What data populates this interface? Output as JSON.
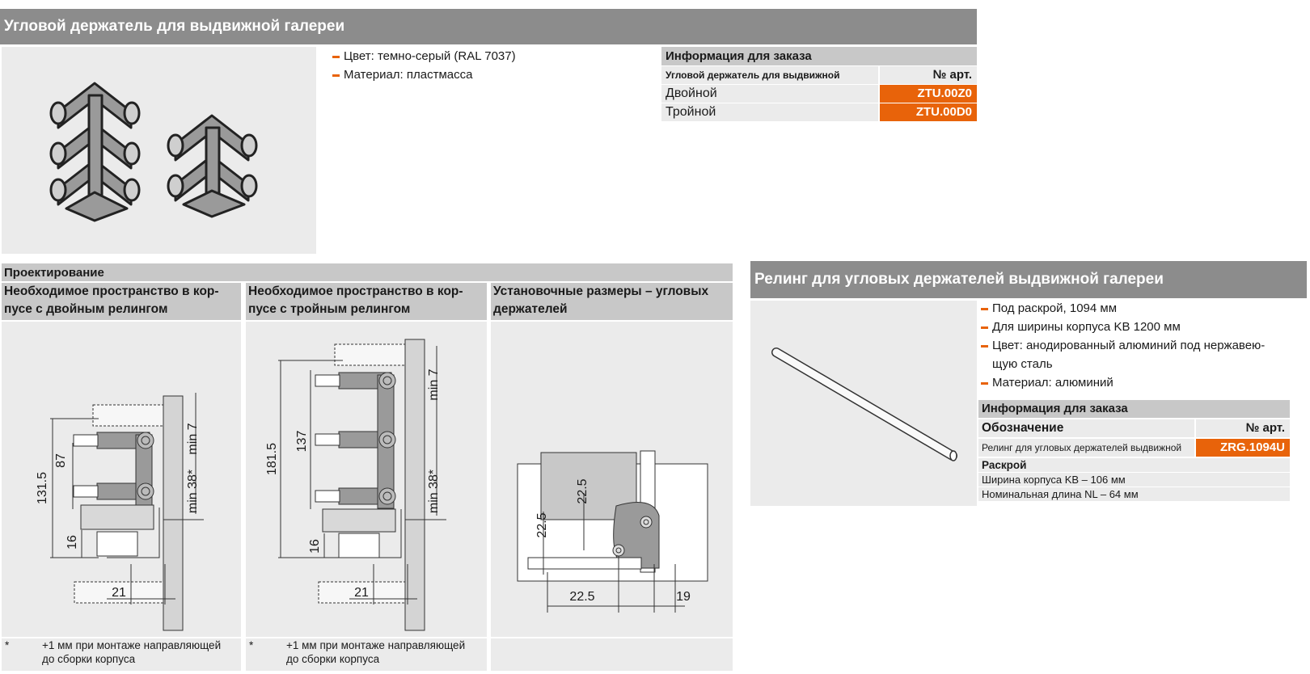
{
  "product1": {
    "title": "Угловой держатель для выдвижной галереи",
    "bullets": [
      "Цвет: темно-серый (RAL 7037)",
      "Материал: пластмасса"
    ],
    "order": {
      "title": "Информация для заказа",
      "col_desc": "Угловой держатель для выдвижной галереи",
      "col_art": "№ арт.",
      "rows": [
        {
          "name": "Двойной",
          "art": "ZTU.00Z0"
        },
        {
          "name": "Тройной",
          "art": "ZTU.00D0"
        }
      ]
    }
  },
  "design": {
    "title": "Проектирование",
    "col1_title": "Необходимое пространство в кор-пусе с двойным релингом",
    "col1_line1": "Необходимое пространство в кор-",
    "col1_line2": "пусе с двойным релингом",
    "col2_line1": "Необходимое пространство в кор-",
    "col2_line2": "пусе с тройным релингом",
    "col3_line1": "Установочные размеры – угловых",
    "col3_line2": "держателей",
    "note_star": "*",
    "note1": "+1 мм при монтаже направляющей до сборки корпуса",
    "note1_line1": "+1 мм при монтаже направляющей",
    "note1_line2": "до сборки корпуса",
    "note2_line1": "+1 мм при монтаже направляющей",
    "note2_line2": "до сборки корпуса",
    "dims1": {
      "h_total": "131.5",
      "h_inner": "87",
      "bottom": "16",
      "width": "21",
      "min_top": "min 7",
      "min_side": "min 38*"
    },
    "dims2": {
      "h_total": "181.5",
      "h_inner": "137",
      "bottom": "16",
      "width": "21",
      "min_top": "min 7",
      "min_side": "min 38*"
    },
    "dims3": {
      "v1": "22.5",
      "v2": "22.5",
      "h1": "22.5",
      "h2": "19"
    }
  },
  "product2": {
    "title": "Релинг для угловых держателей выдвижной галереи",
    "bullets": [
      "Под раскрой, 1094 мм",
      "Для ширины корпуса KB 1200 мм",
      "Цвет: анодированный алюминий под нержавею-",
      "щую сталь",
      "Материал: алюминий"
    ],
    "order": {
      "title": "Информация для заказа",
      "col_desc": "Обозначение",
      "col_art": "№ арт.",
      "row_name": "Релинг для угловых держателей выдвижной галереи",
      "row_art": "ZRG.1094U",
      "cut_title": "Раскрой",
      "cut_lines": [
        "Ширина корпуса KB – 106 мм",
        "Номинальная длина NL – 64 мм"
      ]
    }
  },
  "colors": {
    "accent": "#e8630a",
    "header": "#8c8c8c",
    "bar": "#c8c8c8",
    "panel": "#ebebeb"
  }
}
